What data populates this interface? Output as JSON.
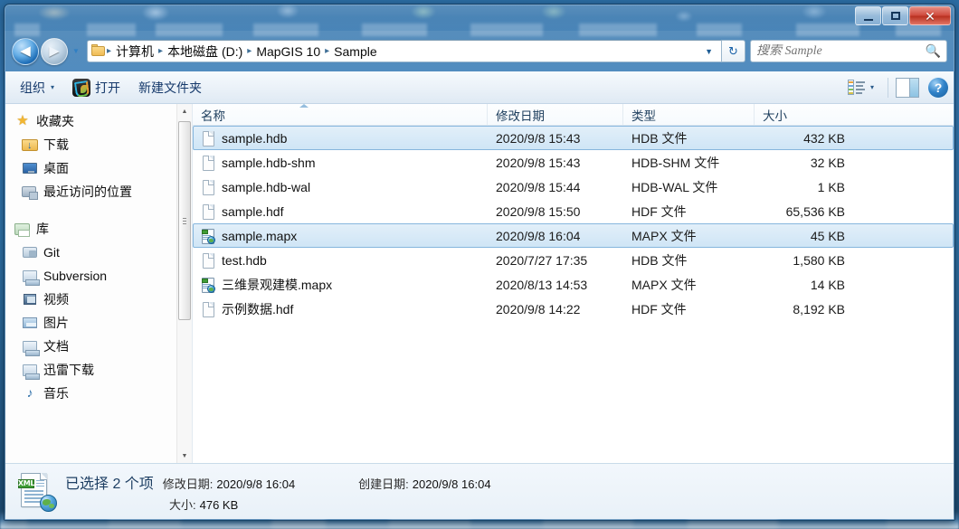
{
  "window": {
    "controls": {
      "minimize": "minimize-button",
      "maximize": "maximize-button",
      "close": "✕"
    }
  },
  "address": {
    "back_label": "◀",
    "forward_label": "▶",
    "history_caret": "▼",
    "folder_icon": "folder-icon",
    "crumbs": [
      "计算机",
      "本地磁盘 (D:)",
      "MapGIS 10",
      "Sample"
    ],
    "separator": "▸",
    "dropdown_caret": "▼",
    "refresh_label": "↻"
  },
  "search": {
    "placeholder": "搜索 Sample",
    "value": "",
    "icon": "search-icon"
  },
  "toolbar": {
    "organize_label": "组织",
    "organize_caret": "▾",
    "open_label": "打开",
    "newfolder_label": "新建文件夹",
    "view_caret": "▾",
    "help_label": "?"
  },
  "navpane": {
    "groups": [
      {
        "header": {
          "label": "收藏夹",
          "icon": "star-icon"
        },
        "items": [
          {
            "label": "下载",
            "icon": "download-folder-icon"
          },
          {
            "label": "桌面",
            "icon": "desktop-icon"
          },
          {
            "label": "最近访问的位置",
            "icon": "recent-places-icon"
          }
        ]
      },
      {
        "header": {
          "label": "库",
          "icon": "library-icon"
        },
        "items": [
          {
            "label": "Git",
            "icon": "git-library-icon"
          },
          {
            "label": "Subversion",
            "icon": "subversion-library-icon"
          },
          {
            "label": "视频",
            "icon": "video-library-icon"
          },
          {
            "label": "图片",
            "icon": "pictures-library-icon"
          },
          {
            "label": "文档",
            "icon": "documents-library-icon"
          },
          {
            "label": "迅雷下载",
            "icon": "xunlei-library-icon"
          },
          {
            "label": "音乐",
            "icon": "music-library-icon"
          }
        ]
      }
    ],
    "scroll_up": "▲",
    "scroll_down": "▼"
  },
  "filelist": {
    "columns": [
      {
        "key": "name",
        "label": "名称"
      },
      {
        "key": "date",
        "label": "修改日期"
      },
      {
        "key": "type",
        "label": "类型"
      },
      {
        "key": "size",
        "label": "大小"
      }
    ],
    "sort_indicator": "ascending",
    "rows": [
      {
        "name": "sample.hdb",
        "date": "2020/9/8 15:43",
        "type": "HDB 文件",
        "size": "432 KB",
        "icon": "generic-file-icon",
        "selected": true
      },
      {
        "name": "sample.hdb-shm",
        "date": "2020/9/8 15:43",
        "type": "HDB-SHM 文件",
        "size": "32 KB",
        "icon": "generic-file-icon",
        "selected": false
      },
      {
        "name": "sample.hdb-wal",
        "date": "2020/9/8 15:44",
        "type": "HDB-WAL 文件",
        "size": "1 KB",
        "icon": "generic-file-icon",
        "selected": false
      },
      {
        "name": "sample.hdf",
        "date": "2020/9/8 15:50",
        "type": "HDF 文件",
        "size": "65,536 KB",
        "icon": "generic-file-icon",
        "selected": false
      },
      {
        "name": "sample.mapx",
        "date": "2020/9/8 16:04",
        "type": "MAPX 文件",
        "size": "45 KB",
        "icon": "mapx-file-icon",
        "selected": true
      },
      {
        "name": "test.hdb",
        "date": "2020/7/27 17:35",
        "type": "HDB 文件",
        "size": "1,580 KB",
        "icon": "generic-file-icon",
        "selected": false
      },
      {
        "name": "三维景观建模.mapx",
        "date": "2020/8/13 14:53",
        "type": "MAPX 文件",
        "size": "14 KB",
        "icon": "mapx-file-icon",
        "selected": false
      },
      {
        "name": "示例数据.hdf",
        "date": "2020/9/8 14:22",
        "type": "HDF 文件",
        "size": "8,192 KB",
        "icon": "generic-file-icon",
        "selected": false
      }
    ]
  },
  "statusbar": {
    "icon": "xml-document-icon",
    "xml_tag": "XML",
    "selection_text": "已选择 2 个项",
    "modified_label": "修改日期:",
    "modified_value": "2020/9/8 16:04",
    "created_label": "创建日期:",
    "created_value": "2020/9/8 16:04",
    "size_label": "大小:",
    "size_value": "476 KB"
  },
  "colors": {
    "selection_fill": "#cfe5f6",
    "selection_border": "#86b6dd",
    "accent": "#1e5d95",
    "close_button": "#b8301f",
    "title_glass": "#bdd7ef"
  }
}
